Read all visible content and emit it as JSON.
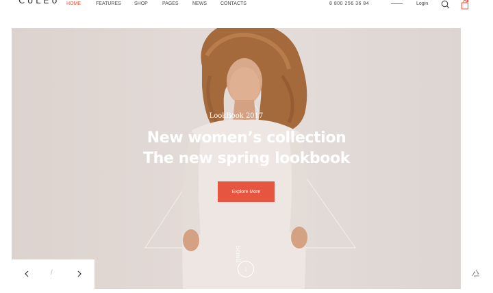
{
  "header": {
    "logo": "CoLEo",
    "nav": [
      {
        "label": "HOME",
        "active": true
      },
      {
        "label": "FEATURES",
        "active": false
      },
      {
        "label": "SHOP",
        "active": false
      },
      {
        "label": "PAGES",
        "active": false
      },
      {
        "label": "NEWS",
        "active": false
      },
      {
        "label": "CONTACTS",
        "active": false
      }
    ],
    "phone": "8 800 256 36 84",
    "login": "Login",
    "icons": {
      "search": "search-icon",
      "bag": "shopping-bag-icon"
    }
  },
  "hero": {
    "kicker": "LookBook 2017",
    "headline_line1": "New women’s collection",
    "headline_line2": "The new spring lookbook",
    "cta": "Explore More",
    "scroll": "Scroll"
  },
  "slider": {
    "separator": "/"
  },
  "colors": {
    "accent": "#e6553f",
    "nav_active": "#e6553f",
    "hero_bg": "#e2dad6"
  }
}
